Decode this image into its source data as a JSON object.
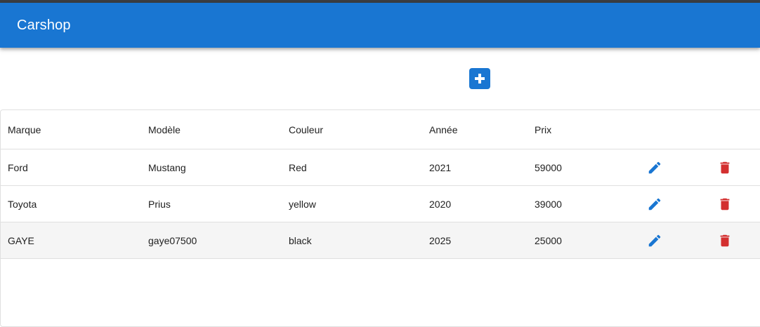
{
  "appbar": {
    "title": "Carshop"
  },
  "toolbar": {
    "add_icon": "add-box-icon"
  },
  "table": {
    "headers": {
      "brand": "Marque",
      "model": "Modèle",
      "color": "Couleur",
      "year": "Année",
      "price": "Prix"
    },
    "rows": [
      {
        "brand": "Ford",
        "model": "Mustang",
        "color": "Red",
        "year": "2021",
        "price": "59000"
      },
      {
        "brand": "Toyota",
        "model": "Prius",
        "color": "yellow",
        "year": "2020",
        "price": "39000"
      },
      {
        "brand": "GAYE",
        "model": "gaye07500",
        "color": "black",
        "year": "2025",
        "price": "25000"
      }
    ],
    "row_actions": {
      "edit_icon": "pencil-icon",
      "delete_icon": "trash-icon"
    }
  },
  "colors": {
    "primary": "#1976d2",
    "danger": "#d32f2f",
    "hover_row": "#f5f5f5"
  }
}
